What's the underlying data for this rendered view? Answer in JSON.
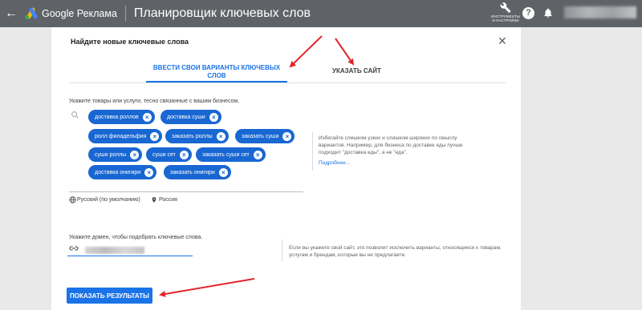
{
  "topbar": {
    "brand": "Google Реклама",
    "title": "Планировщик ключевых слов",
    "tools_label_line1": "ИНСТРУМЕНТЫ",
    "tools_label_line2": "И НАСТРОЙКИ",
    "help": "?"
  },
  "panel": {
    "title": "Найдите новые ключевые слова",
    "tabs": [
      {
        "label": "ВВЕСТИ СВОИ ВАРИАНТЫ КЛЮЧЕВЫХ СЛОВ",
        "active": true
      },
      {
        "label": "УКАЗАТЬ САЙТ",
        "active": false
      }
    ],
    "keywords_prompt": "Укажите товары или услуги, тесно связанные с вашим бизнесом.",
    "keywords": [
      "доставка роллов",
      "доставка суши",
      "ролл филадельфия",
      "заказать роллы",
      "заказать суши",
      "суши роллы",
      "суши сет",
      "заказать суши сет",
      "доставка онигири",
      "заказать онигири"
    ],
    "hint": "Избегайте слишком узких и слишком широких по смыслу вариантов. Например, для бизнеса по доставке еды лучше подходит \"доставка еды\", а не \"еда\".",
    "more_link": "Подробнее...",
    "language": "Русский (по умолчанию)",
    "location": "Россия",
    "domain_prompt": "Укажите домен, чтобы подобрать ключевые слова.",
    "site_hint": "Если вы укажете свой сайт, это позволит исключить варианты, относящиеся к товарам, услугам и брендам, которые вы не предлагаете.",
    "show_results": "ПОКАЗАТЬ РЕЗУЛЬТАТЫ"
  },
  "colors": {
    "topbar": "#5f6368",
    "accent": "#1a73e8",
    "chip": "#1967d2",
    "annotation": "#e3262a"
  }
}
